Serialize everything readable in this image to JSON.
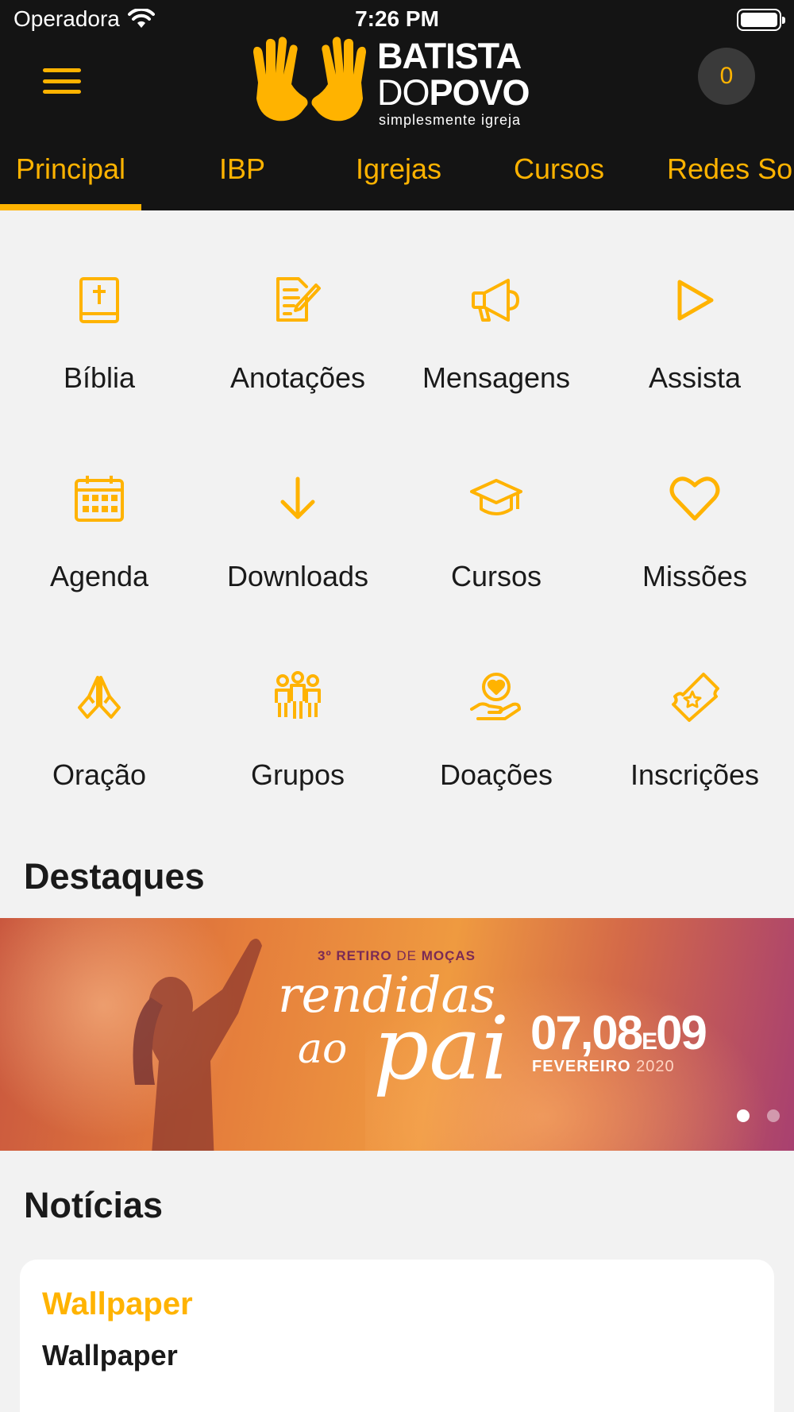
{
  "status_bar": {
    "carrier": "Operadora",
    "time": "7:26 PM"
  },
  "header": {
    "logo_line1": "BATISTA",
    "logo_line2_a": "DO",
    "logo_line2_b": "POVO",
    "logo_tagline": "simplesmente igreja",
    "cart_count": "0"
  },
  "tabs": [
    {
      "label": "Principal",
      "active": true
    },
    {
      "label": "IBP"
    },
    {
      "label": "Igrejas"
    },
    {
      "label": "Cursos"
    },
    {
      "label": "Redes So"
    }
  ],
  "grid": [
    {
      "label": "Bíblia",
      "icon": "bible-icon"
    },
    {
      "label": "Anotações",
      "icon": "notes-icon"
    },
    {
      "label": "Mensagens",
      "icon": "megaphone-icon"
    },
    {
      "label": "Assista",
      "icon": "play-icon"
    },
    {
      "label": "Agenda",
      "icon": "calendar-icon"
    },
    {
      "label": "Downloads",
      "icon": "download-arrow-icon"
    },
    {
      "label": "Cursos",
      "icon": "graduation-cap-icon"
    },
    {
      "label": "Missões",
      "icon": "heart-icon"
    },
    {
      "label": "Oração",
      "icon": "praying-hands-icon"
    },
    {
      "label": "Grupos",
      "icon": "group-people-icon"
    },
    {
      "label": "Doações",
      "icon": "donation-hand-heart-icon"
    },
    {
      "label": "Inscrições",
      "icon": "ticket-icon"
    }
  ],
  "highlights": {
    "title": "Destaques",
    "banner": {
      "kicker_bold": "3º RETIRO",
      "kicker_light": "DE",
      "kicker_end": "MOÇAS",
      "script_line1": "rendidas",
      "script_line2": "ao",
      "script_line3": "pai",
      "dates_a": "07,08",
      "dates_e": "E",
      "dates_b": "09",
      "month": "FEVEREIRO",
      "year": "2020"
    },
    "page_count": 2,
    "active_page": 1
  },
  "news": {
    "title": "Notícias",
    "items": [
      {
        "title": "Wallpaper",
        "subtitle": "Wallpaper"
      }
    ]
  },
  "colors": {
    "accent": "#ffb300",
    "header_bg": "#141414",
    "page_bg": "#f2f2f2"
  }
}
